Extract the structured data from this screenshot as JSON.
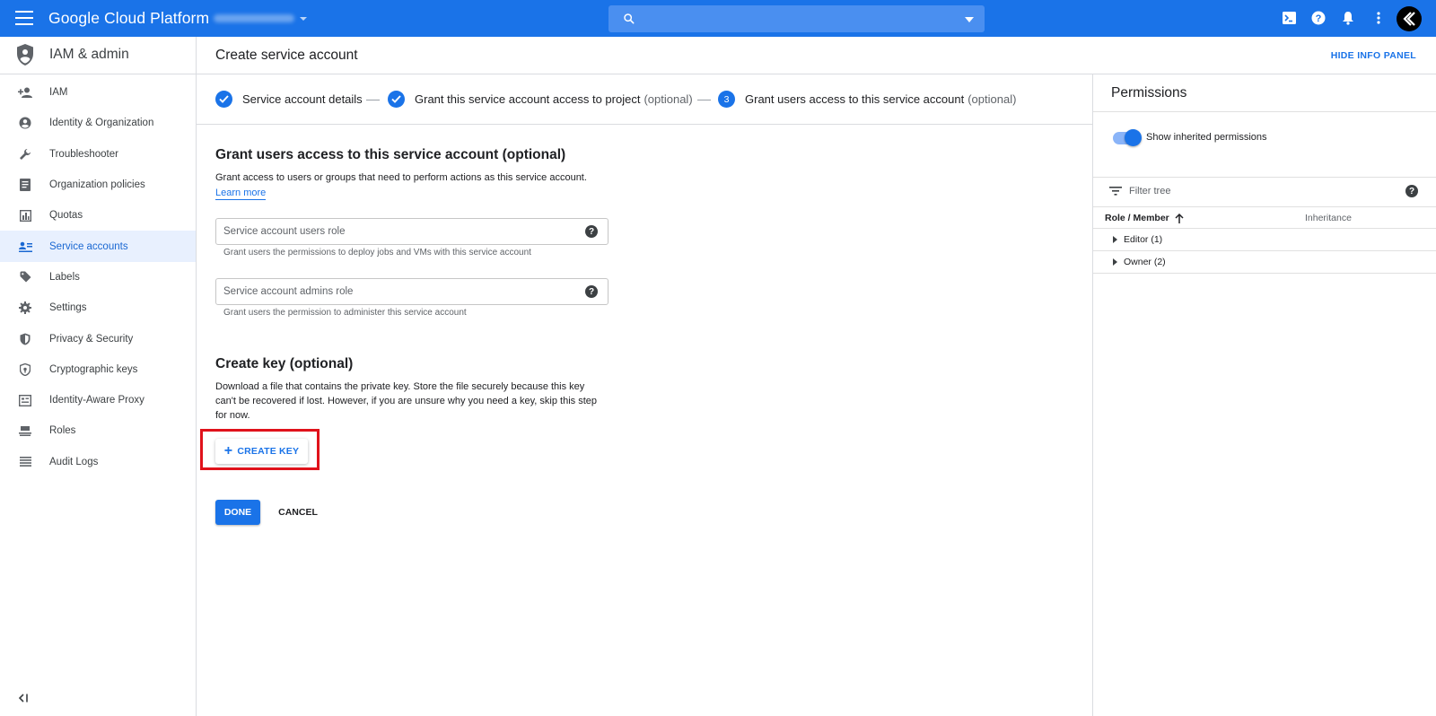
{
  "topbar": {
    "brand": "Google Cloud Platform",
    "search_placeholder": ""
  },
  "sidebar": {
    "title": "IAM & admin",
    "items": [
      {
        "label": "IAM",
        "icon": "person-add-icon"
      },
      {
        "label": "Identity & Organization",
        "icon": "account-circle-icon"
      },
      {
        "label": "Troubleshooter",
        "icon": "wrench-icon"
      },
      {
        "label": "Organization policies",
        "icon": "document-icon"
      },
      {
        "label": "Quotas",
        "icon": "quota-icon"
      },
      {
        "label": "Service accounts",
        "icon": "service-account-icon",
        "active": true
      },
      {
        "label": "Labels",
        "icon": "label-icon"
      },
      {
        "label": "Settings",
        "icon": "gear-icon"
      },
      {
        "label": "Privacy & Security",
        "icon": "shield-icon"
      },
      {
        "label": "Cryptographic keys",
        "icon": "security-shield-icon"
      },
      {
        "label": "Identity-Aware Proxy",
        "icon": "proxy-icon"
      },
      {
        "label": "Roles",
        "icon": "roles-icon"
      },
      {
        "label": "Audit Logs",
        "icon": "list-icon"
      }
    ]
  },
  "page": {
    "title": "Create service account",
    "hide_info_panel": "HIDE INFO PANEL"
  },
  "stepper": {
    "steps": [
      {
        "label": "Service account details",
        "optional": "",
        "state": "done"
      },
      {
        "label": "Grant this service account access to project",
        "optional": "(optional)",
        "state": "done"
      },
      {
        "label": "Grant users access to this service account",
        "optional": "(optional)",
        "state": "current",
        "number": "3"
      }
    ]
  },
  "grant": {
    "heading": "Grant users access to this service account (optional)",
    "description": "Grant access to users or groups that need to perform actions as this service account.",
    "learn_more": "Learn more",
    "users_role": {
      "placeholder": "Service account users role",
      "hint": "Grant users the permissions to deploy jobs and VMs with this service account"
    },
    "admins_role": {
      "placeholder": "Service account admins role",
      "hint": "Grant users the permission to administer this service account"
    }
  },
  "create_key": {
    "heading": "Create key (optional)",
    "description_line1": "Download a file that contains the private key. Store the file securely because this key",
    "description_line2": "can't be recovered if lost. However, if you are unsure why you need a key, skip this step",
    "description_line3": "for now.",
    "button": "CREATE KEY"
  },
  "actions": {
    "done": "DONE",
    "cancel": "CANCEL"
  },
  "permissions": {
    "title": "Permissions",
    "toggle_label": "Show inherited permissions",
    "toggle_on": true,
    "filter_placeholder": "Filter tree",
    "columns": {
      "role": "Role / Member",
      "inheritance": "Inheritance"
    },
    "rows": [
      {
        "label": "Editor (1)"
      },
      {
        "label": "Owner (2)"
      }
    ]
  },
  "colors": {
    "brand_blue": "#1a73e8",
    "highlight_red": "#e0121b"
  }
}
